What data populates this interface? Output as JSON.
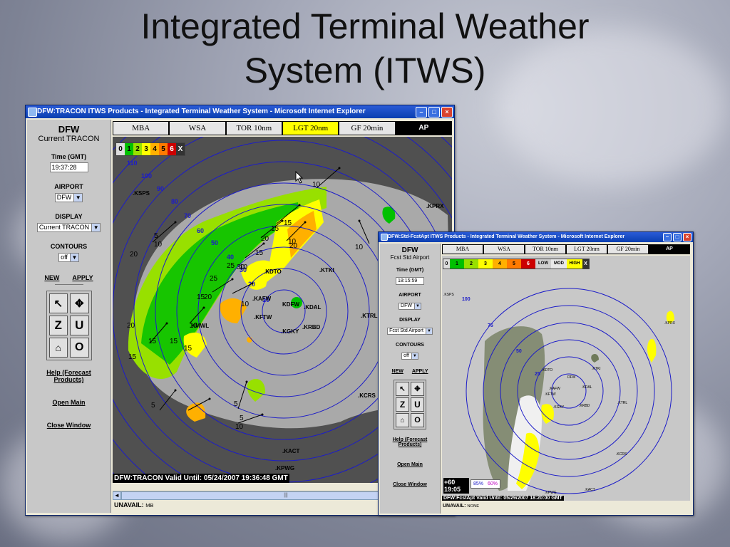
{
  "slide": {
    "title_line1": "Integrated Terminal Weather",
    "title_line2": "System (ITWS)"
  },
  "win1": {
    "title": "DFW:TRACON ITWS Products - Integrated Terminal Weather System - Microsoft Internet Explorer",
    "code": "DFW",
    "subtitle": "Current TRACON",
    "time_label": "Time (GMT)",
    "time_value": "19:37:28",
    "airport_label": "AIRPORT",
    "airport_value": "DFW",
    "display_label": "DISPLAY",
    "display_value": "Current TRACON",
    "contours_label": "CONTOURS",
    "contours_value": "off",
    "new_label": "NEW",
    "apply_label": "APPLY",
    "help_label": "Help (Forecast Products)",
    "open_main_label": "Open Main",
    "close_window_label": "Close Window",
    "tabs": [
      "MBA",
      "WSA",
      "TOR 10nm",
      "LGT 20nm",
      "GF 20min",
      "AP"
    ],
    "selected_tab": "LGT 20nm",
    "legend": [
      "0",
      "1",
      "2",
      "3",
      "4",
      "5",
      "6",
      "X"
    ],
    "status": "DFW:TRACON Valid Until: 05/24/2007 19:36:48 GMT",
    "unavail_label": "UNAVAIL:",
    "unavail_value": "MB",
    "ring_labels": [
      "110",
      "100",
      "90",
      "80",
      "70",
      "60",
      "50",
      "40",
      "30",
      "20",
      "10"
    ],
    "stations": [
      ".KSPS",
      ".KPRX",
      ".KTKI",
      ".KDTO",
      ".KAFW",
      ".KDAL",
      ".KFTW",
      ".KGKY",
      ".KRBD",
      ".KTRL",
      ".KMWL",
      ".KCRS",
      ".KACT",
      ".KPWG",
      "KDFW"
    ],
    "cell_values": [
      "10",
      "10",
      "5",
      "10",
      "15",
      "15",
      "20",
      "15",
      "10",
      "20",
      "25",
      "30",
      "25",
      "20",
      "15",
      "10",
      "15",
      "15",
      "15",
      "10",
      "5",
      "5",
      "5",
      "10",
      "10",
      "20",
      "20",
      "15"
    ],
    "arrow_glyphs": [
      "◄",
      "►"
    ],
    "scroll_thumb_glyph": "|||"
  },
  "win2": {
    "title": "DFW:Std-FcstApt ITWS Products - Integrated Terminal Weather System - Microsoft Internet Explorer",
    "code": "DFW",
    "subtitle": "Fcst Std Airport",
    "time_label": "Time (GMT)",
    "time_value": "18:15:59",
    "airport_label": "AIRPORT",
    "airport_value": "DFW",
    "display_label": "DISPLAY",
    "display_value": "Fcst Std Airport",
    "contours_label": "CONTOURS",
    "contours_value": "off",
    "new_label": "NEW",
    "apply_label": "APPLY",
    "help_label": "Help (Forecast Products)",
    "open_main_label": "Open Main",
    "close_window_label": "Close Window",
    "tabs": [
      "MBA",
      "WSA",
      "TOR 10nm",
      "LGT 20nm",
      "GF 20min",
      "AP"
    ],
    "legend": [
      "0",
      "1",
      "2",
      "3",
      "4",
      "5",
      "6",
      "LOW",
      "MOD",
      "HIGH",
      "X"
    ],
    "status": "DFW:FcstApt Valid Until: 05/29/2007 18:20:00 GMT",
    "unavail_label": "UNAVAIL:",
    "unavail_value": "NONE",
    "forecast_offset": "+60",
    "forecast_time": "19:05",
    "confidence": [
      "85%",
      "60%"
    ],
    "ring_labels": [
      "100",
      "75",
      "50",
      "25"
    ],
    "stations": [
      ".KSPS",
      ".KPRX",
      ".KTKI",
      ".KDTO",
      ".KAFW",
      ".KDAL",
      ".KFTW",
      ".KGKY",
      ".KRBD",
      ".KTRL",
      ".KCRS",
      ".KACT",
      ".KPWG",
      "DFW"
    ]
  },
  "colors": {
    "radar_bg": "#505050",
    "coverage": "#a9a9a9",
    "ring": "#1c1cc8",
    "level1": "#00c000",
    "level2": "#98e000",
    "level3": "#ffff00",
    "level4": "#ffb000",
    "level5": "#ff7a00",
    "level6": "#cc0000"
  },
  "icons": [
    "pointer-icon",
    "pan-icon",
    "zoom-in-icon",
    "undo-icon",
    "home-icon",
    "circle-icon"
  ]
}
